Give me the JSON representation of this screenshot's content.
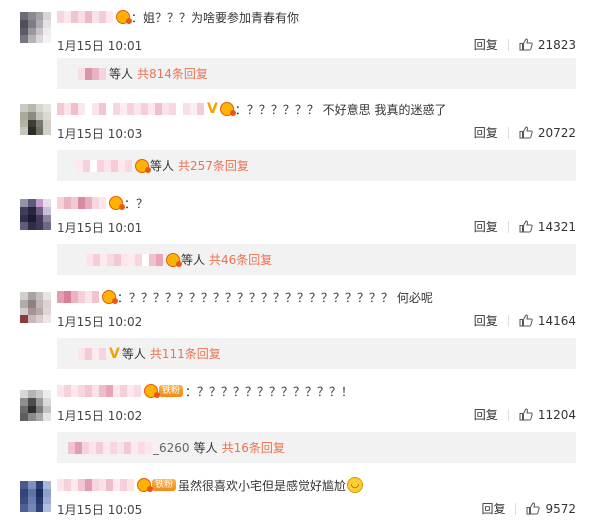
{
  "comments": [
    {
      "text": "：姐？？？为啥要参加青春有你",
      "time": "1月15日 10:01",
      "reply_label": "回复",
      "likes": "21823",
      "sub": {
        "deng": "等人",
        "count": "共814条回复"
      }
    },
    {
      "text": "：？？？？？？ 不好意思 我真的迷惑了",
      "time": "1月15日 10:03",
      "reply_label": "回复",
      "likes": "20722",
      "sub": {
        "deng": "等人",
        "count": "共257条回复"
      }
    },
    {
      "text": "：？",
      "time": "1月15日 10:01",
      "reply_label": "回复",
      "likes": "14321",
      "sub": {
        "deng": "等人",
        "count": "共46条回复"
      }
    },
    {
      "text": "：？？？？？？？？？？？？？？？？？？？？？？ 何必呢",
      "time": "1月15日 10:02",
      "reply_label": "回复",
      "likes": "14164",
      "sub": {
        "deng": "等人",
        "count": "共111条回复"
      }
    },
    {
      "text": "：？？？？？？？？？？？？！",
      "time": "1月15日 10:02",
      "reply_label": "回复",
      "likes": "11204",
      "fan_label": "铁粉",
      "sub": {
        "prefix": "_6260",
        "deng": "等人",
        "count": "共16条回复"
      }
    },
    {
      "text": "虽然很喜欢小宅但是感觉好尴尬",
      "time": "1月15日 10:05",
      "reply_label": "回复",
      "likes": "9572",
      "fan_label": "铁粉"
    }
  ],
  "colors": {
    "link_orange": "#eb7350",
    "sub_bg": "#f2f2f2",
    "badge_gold": "#ffb300"
  }
}
